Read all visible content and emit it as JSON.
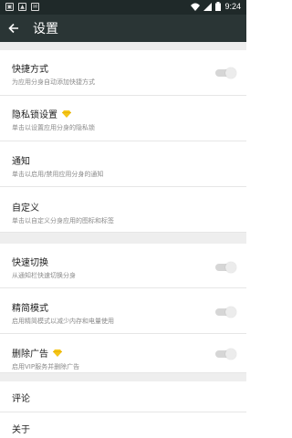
{
  "statusbar": {
    "time": "9:24"
  },
  "toolbar": {
    "title": "设置"
  },
  "settings": {
    "shortcut": {
      "title": "快捷方式",
      "sub": "为应用分身自动添加快捷方式"
    },
    "privacy_lock": {
      "title": "隐私锁设置",
      "sub": "单击以设置应用分身的隐私锁"
    },
    "notification": {
      "title": "通知",
      "sub": "单击以启用/禁用应用分身的通知"
    },
    "customize": {
      "title": "自定义",
      "sub": "单击以自定义分身应用的图标和标签"
    },
    "quick_switch": {
      "title": "快速切换",
      "sub": "从通知栏快速切换分身"
    },
    "lite_mode": {
      "title": "精简模式",
      "sub": "启用精简模式以减少内存和电量使用"
    },
    "remove_ads": {
      "title": "删除广告",
      "sub": "启用VIP服务并删除广告"
    },
    "review": {
      "title": "评论"
    },
    "about": {
      "title": "关于"
    }
  },
  "colors": {
    "statusbar": "#1f2929",
    "toolbar": "#2a3535",
    "vip": "#f5c518"
  }
}
